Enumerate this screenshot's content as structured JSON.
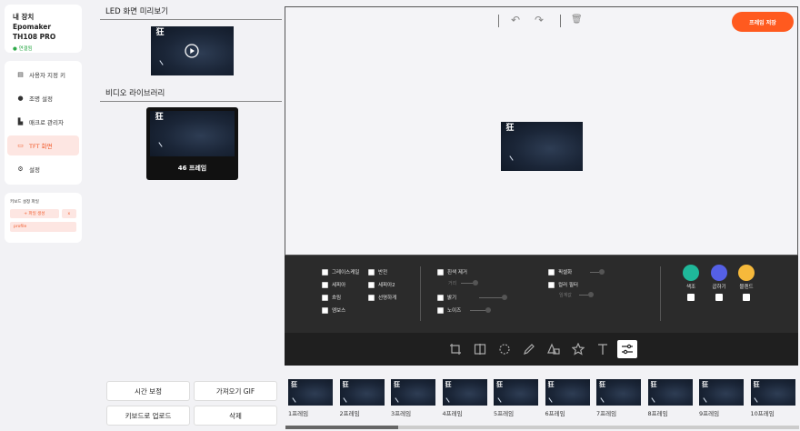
{
  "device": {
    "name": "내 장치 Epomaker TH108 PRO",
    "status": "연결됨"
  },
  "nav": [
    {
      "label": "사용자 지정 키",
      "icon": "keyboard-icon"
    },
    {
      "label": "조명 설정",
      "icon": "bulb-icon"
    },
    {
      "label": "매크로 관리자",
      "icon": "macro-icon"
    },
    {
      "label": "TFT 화면",
      "icon": "monitor-icon",
      "active": true
    },
    {
      "label": "설정",
      "icon": "gear-icon"
    }
  ],
  "profile": {
    "title": "키보드 설정 파일",
    "new_label": "+ 파일 생성",
    "delete_label": "x",
    "item": "profile"
  },
  "preview": {
    "title": "LED 화면 미리보기"
  },
  "library": {
    "title": "비디오 라이브러리",
    "card_label": "46 프레임"
  },
  "toolbar": {
    "save_label": "프레임 저장"
  },
  "filters": {
    "grayscale": "그레이스케일",
    "invert": "반전",
    "sepia": "세피아",
    "sepia2": "세피아2",
    "blur": "흐림",
    "sharpen": "선명하게",
    "emboss": "엠보스",
    "remove_white": "흰색 제거",
    "distance": "거리",
    "brightness": "밝기",
    "noise": "노이즈",
    "pixelate": "픽셀화",
    "color_filter": "컬러 필터",
    "threshold": "임계값",
    "tint": "색조",
    "multiply": "곱하기",
    "blend": "블렌드"
  },
  "colors": {
    "tint": "#1fb89a",
    "multiply": "#5560e6",
    "blend": "#f6b93b",
    "accent": "#ff5a1f"
  },
  "bottom_buttons": {
    "time_correction": "시간 보정",
    "import_gif": "가져오기 GIF",
    "upload": "키보드로 업로드",
    "delete": "삭제"
  },
  "frames": [
    "1프레임",
    "2프레임",
    "3프레임",
    "4프레임",
    "5프레임",
    "6프레임",
    "7프레임",
    "8프레임",
    "9프레임",
    "10프레임"
  ],
  "filmstrip_scroll": 0.22
}
